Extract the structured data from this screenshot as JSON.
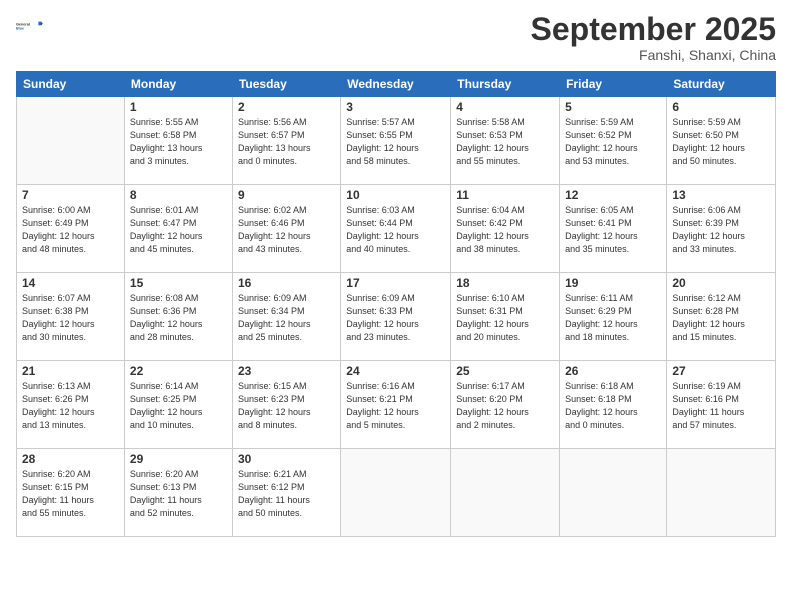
{
  "header": {
    "logo_line1": "General",
    "logo_line2": "Blue",
    "month": "September 2025",
    "location": "Fanshi, Shanxi, China"
  },
  "weekdays": [
    "Sunday",
    "Monday",
    "Tuesday",
    "Wednesday",
    "Thursday",
    "Friday",
    "Saturday"
  ],
  "weeks": [
    [
      {
        "day": "",
        "info": ""
      },
      {
        "day": "1",
        "info": "Sunrise: 5:55 AM\nSunset: 6:58 PM\nDaylight: 13 hours\nand 3 minutes."
      },
      {
        "day": "2",
        "info": "Sunrise: 5:56 AM\nSunset: 6:57 PM\nDaylight: 13 hours\nand 0 minutes."
      },
      {
        "day": "3",
        "info": "Sunrise: 5:57 AM\nSunset: 6:55 PM\nDaylight: 12 hours\nand 58 minutes."
      },
      {
        "day": "4",
        "info": "Sunrise: 5:58 AM\nSunset: 6:53 PM\nDaylight: 12 hours\nand 55 minutes."
      },
      {
        "day": "5",
        "info": "Sunrise: 5:59 AM\nSunset: 6:52 PM\nDaylight: 12 hours\nand 53 minutes."
      },
      {
        "day": "6",
        "info": "Sunrise: 5:59 AM\nSunset: 6:50 PM\nDaylight: 12 hours\nand 50 minutes."
      }
    ],
    [
      {
        "day": "7",
        "info": "Sunrise: 6:00 AM\nSunset: 6:49 PM\nDaylight: 12 hours\nand 48 minutes."
      },
      {
        "day": "8",
        "info": "Sunrise: 6:01 AM\nSunset: 6:47 PM\nDaylight: 12 hours\nand 45 minutes."
      },
      {
        "day": "9",
        "info": "Sunrise: 6:02 AM\nSunset: 6:46 PM\nDaylight: 12 hours\nand 43 minutes."
      },
      {
        "day": "10",
        "info": "Sunrise: 6:03 AM\nSunset: 6:44 PM\nDaylight: 12 hours\nand 40 minutes."
      },
      {
        "day": "11",
        "info": "Sunrise: 6:04 AM\nSunset: 6:42 PM\nDaylight: 12 hours\nand 38 minutes."
      },
      {
        "day": "12",
        "info": "Sunrise: 6:05 AM\nSunset: 6:41 PM\nDaylight: 12 hours\nand 35 minutes."
      },
      {
        "day": "13",
        "info": "Sunrise: 6:06 AM\nSunset: 6:39 PM\nDaylight: 12 hours\nand 33 minutes."
      }
    ],
    [
      {
        "day": "14",
        "info": "Sunrise: 6:07 AM\nSunset: 6:38 PM\nDaylight: 12 hours\nand 30 minutes."
      },
      {
        "day": "15",
        "info": "Sunrise: 6:08 AM\nSunset: 6:36 PM\nDaylight: 12 hours\nand 28 minutes."
      },
      {
        "day": "16",
        "info": "Sunrise: 6:09 AM\nSunset: 6:34 PM\nDaylight: 12 hours\nand 25 minutes."
      },
      {
        "day": "17",
        "info": "Sunrise: 6:09 AM\nSunset: 6:33 PM\nDaylight: 12 hours\nand 23 minutes."
      },
      {
        "day": "18",
        "info": "Sunrise: 6:10 AM\nSunset: 6:31 PM\nDaylight: 12 hours\nand 20 minutes."
      },
      {
        "day": "19",
        "info": "Sunrise: 6:11 AM\nSunset: 6:29 PM\nDaylight: 12 hours\nand 18 minutes."
      },
      {
        "day": "20",
        "info": "Sunrise: 6:12 AM\nSunset: 6:28 PM\nDaylight: 12 hours\nand 15 minutes."
      }
    ],
    [
      {
        "day": "21",
        "info": "Sunrise: 6:13 AM\nSunset: 6:26 PM\nDaylight: 12 hours\nand 13 minutes."
      },
      {
        "day": "22",
        "info": "Sunrise: 6:14 AM\nSunset: 6:25 PM\nDaylight: 12 hours\nand 10 minutes."
      },
      {
        "day": "23",
        "info": "Sunrise: 6:15 AM\nSunset: 6:23 PM\nDaylight: 12 hours\nand 8 minutes."
      },
      {
        "day": "24",
        "info": "Sunrise: 6:16 AM\nSunset: 6:21 PM\nDaylight: 12 hours\nand 5 minutes."
      },
      {
        "day": "25",
        "info": "Sunrise: 6:17 AM\nSunset: 6:20 PM\nDaylight: 12 hours\nand 2 minutes."
      },
      {
        "day": "26",
        "info": "Sunrise: 6:18 AM\nSunset: 6:18 PM\nDaylight: 12 hours\nand 0 minutes."
      },
      {
        "day": "27",
        "info": "Sunrise: 6:19 AM\nSunset: 6:16 PM\nDaylight: 11 hours\nand 57 minutes."
      }
    ],
    [
      {
        "day": "28",
        "info": "Sunrise: 6:20 AM\nSunset: 6:15 PM\nDaylight: 11 hours\nand 55 minutes."
      },
      {
        "day": "29",
        "info": "Sunrise: 6:20 AM\nSunset: 6:13 PM\nDaylight: 11 hours\nand 52 minutes."
      },
      {
        "day": "30",
        "info": "Sunrise: 6:21 AM\nSunset: 6:12 PM\nDaylight: 11 hours\nand 50 minutes."
      },
      {
        "day": "",
        "info": ""
      },
      {
        "day": "",
        "info": ""
      },
      {
        "day": "",
        "info": ""
      },
      {
        "day": "",
        "info": ""
      }
    ]
  ]
}
